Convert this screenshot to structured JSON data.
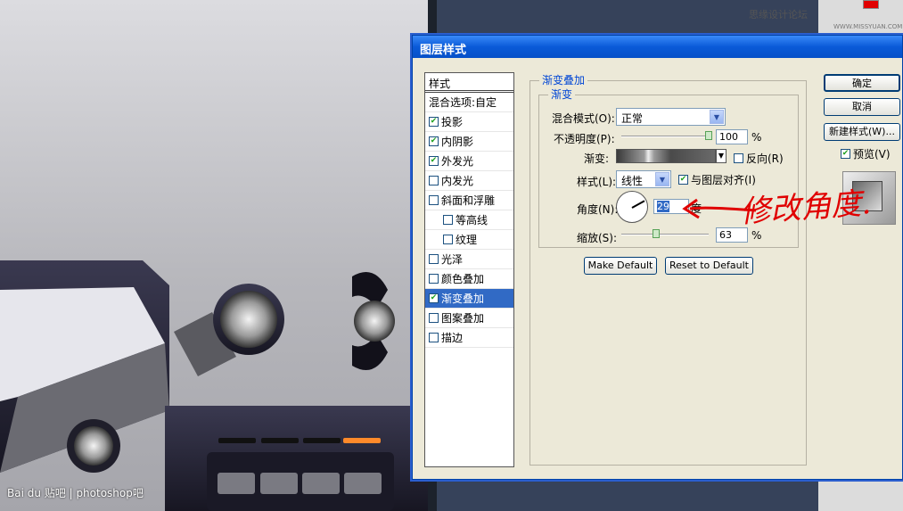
{
  "dialog": {
    "title": "图层样式"
  },
  "styles_panel": {
    "header": "样式",
    "items": [
      {
        "label": "混合选项:自定",
        "checkbox": false,
        "checked": false,
        "indent": false,
        "selected": false
      },
      {
        "label": "投影",
        "checkbox": true,
        "checked": true,
        "indent": false,
        "selected": false
      },
      {
        "label": "内阴影",
        "checkbox": true,
        "checked": true,
        "indent": false,
        "selected": false
      },
      {
        "label": "外发光",
        "checkbox": true,
        "checked": true,
        "indent": false,
        "selected": false
      },
      {
        "label": "内发光",
        "checkbox": true,
        "checked": false,
        "indent": false,
        "selected": false
      },
      {
        "label": "斜面和浮雕",
        "checkbox": true,
        "checked": false,
        "indent": false,
        "selected": false
      },
      {
        "label": "等高线",
        "checkbox": true,
        "checked": false,
        "indent": true,
        "selected": false
      },
      {
        "label": "纹理",
        "checkbox": true,
        "checked": false,
        "indent": true,
        "selected": false
      },
      {
        "label": "光泽",
        "checkbox": true,
        "checked": false,
        "indent": false,
        "selected": false
      },
      {
        "label": "颜色叠加",
        "checkbox": true,
        "checked": false,
        "indent": false,
        "selected": false
      },
      {
        "label": "渐变叠加",
        "checkbox": true,
        "checked": true,
        "indent": false,
        "selected": true
      },
      {
        "label": "图案叠加",
        "checkbox": true,
        "checked": false,
        "indent": false,
        "selected": false
      },
      {
        "label": "描边",
        "checkbox": true,
        "checked": false,
        "indent": false,
        "selected": false
      }
    ]
  },
  "gradient_overlay": {
    "section_title": "渐变叠加",
    "group_title": "渐变",
    "blend_mode": {
      "label": "混合模式(O):",
      "value": "正常"
    },
    "opacity": {
      "label": "不透明度(P):",
      "value": "100",
      "unit": "%",
      "level": 1.0
    },
    "gradient": {
      "label": "渐变:",
      "reverse_label": "反向(R)",
      "reverse_checked": false
    },
    "style": {
      "label": "样式(L):",
      "value": "线性",
      "align_label": "与图层对齐(I)",
      "align_checked": true
    },
    "angle": {
      "label": "角度(N):",
      "value": "29",
      "unit": "度"
    },
    "scale": {
      "label": "缩放(S):",
      "value": "63",
      "unit": "%",
      "level": 0.4
    },
    "make_default": "Make Default",
    "reset_default": "Reset to Default"
  },
  "buttons": {
    "ok": "确定",
    "cancel": "取消",
    "new_style": "新建样式(W)...",
    "preview_label": "预览(V)",
    "preview_checked": true
  },
  "annotation": "修改角度.",
  "watermark": {
    "site": "思缘设计论坛",
    "url": "WWW.MISSYUAN.COM",
    "source": "Bai du 贴吧 | photoshop吧"
  },
  "colors": {
    "accent": "#316ac5",
    "titlebar": "#0a5ad8",
    "annotation": "#e00000"
  }
}
